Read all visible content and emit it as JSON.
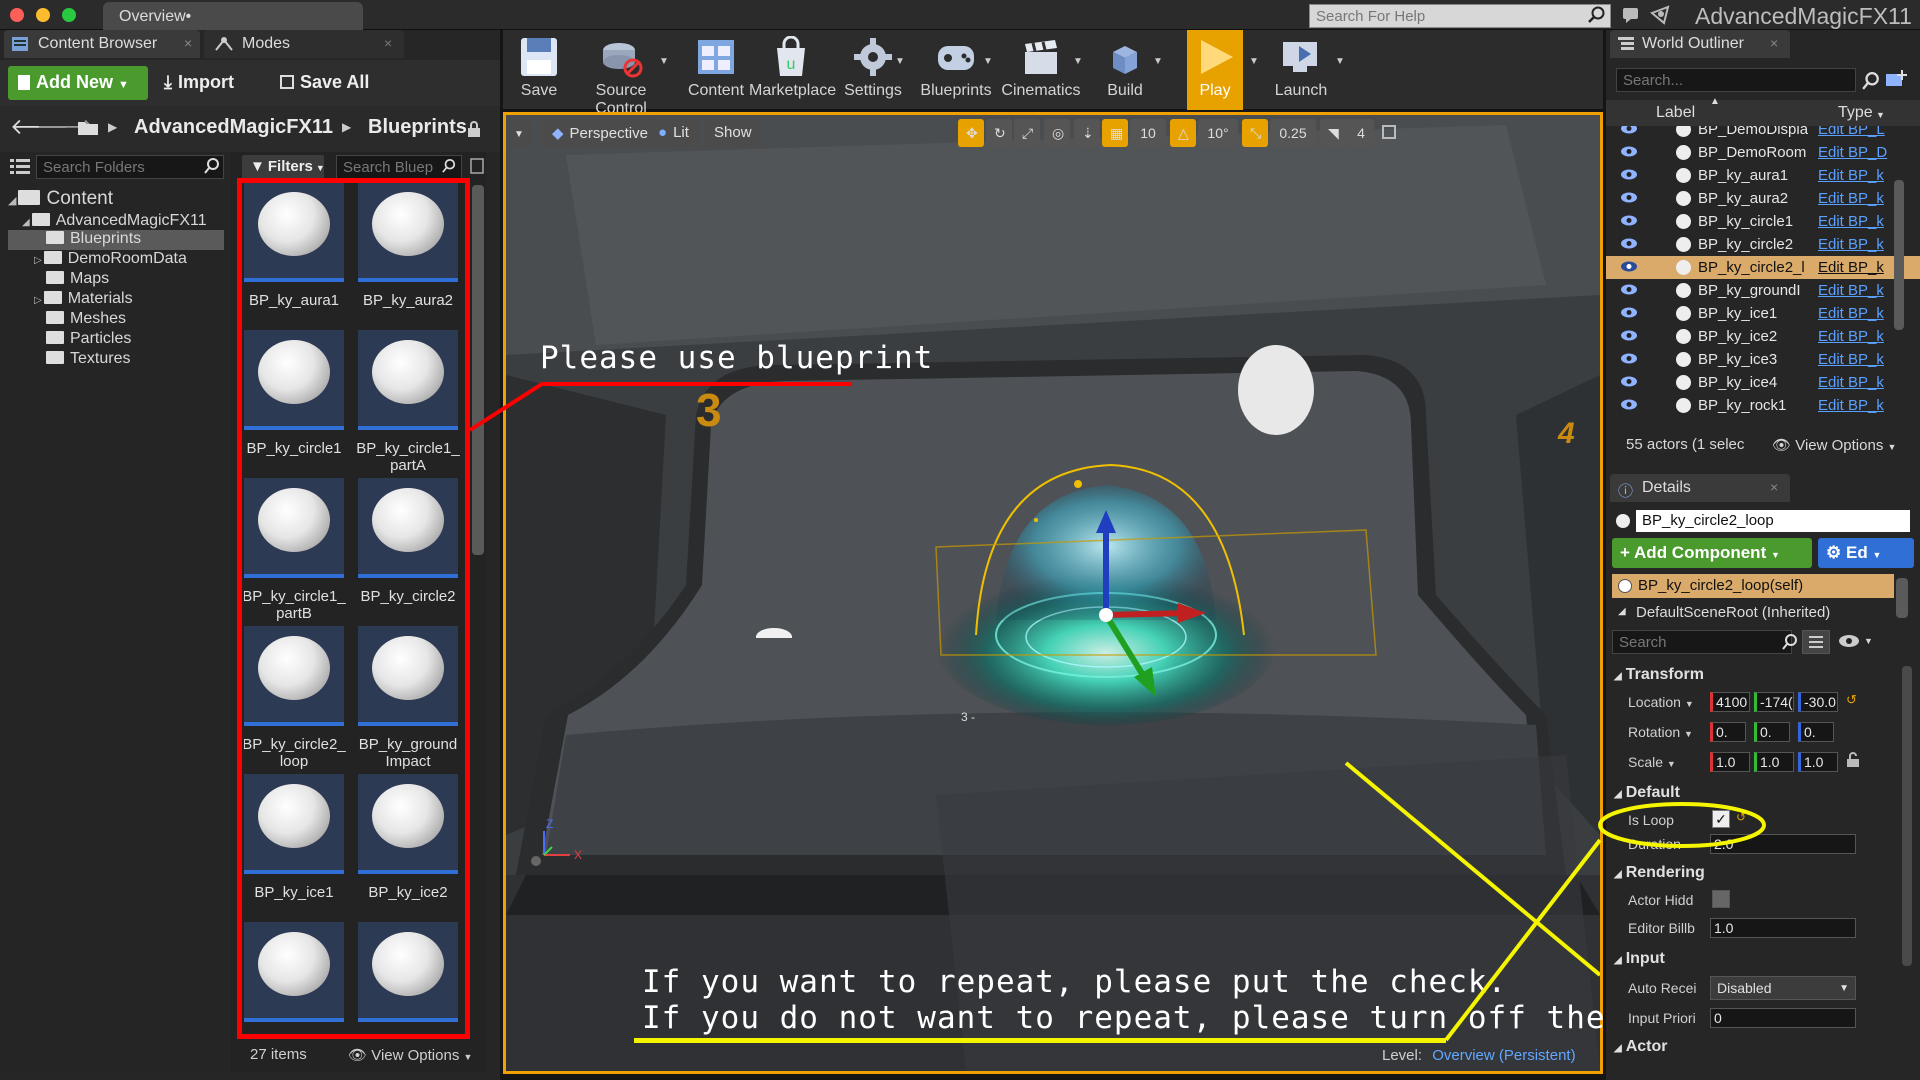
{
  "window": {
    "tab": "Overview•",
    "help_search_placeholder": "Search For Help",
    "app_title": "AdvancedMagicFX11"
  },
  "content_browser": {
    "tab_label": "Content Browser",
    "modes_tab": "Modes",
    "add_new": "Add New",
    "import": "Import",
    "save_all": "Save All",
    "path_root": "AdvancedMagicFX11",
    "path_leaf": "Blueprints",
    "search_folders": "Search Folders",
    "filters": "Filters",
    "search_assets": "Search Bluep",
    "tree": {
      "root": "Content",
      "items": [
        "AdvancedMagicFX11",
        "Blueprints",
        "DemoRoomData",
        "Maps",
        "Materials",
        "Meshes",
        "Particles",
        "Textures"
      ]
    },
    "assets": [
      {
        "l1": "BP_ky_aura1",
        "l2": ""
      },
      {
        "l1": "BP_ky_aura2",
        "l2": ""
      },
      {
        "l1": "BP_ky_circle1",
        "l2": ""
      },
      {
        "l1": "BP_ky_circle1_",
        "l2": "partA"
      },
      {
        "l1": "BP_ky_circle1_",
        "l2": "partB"
      },
      {
        "l1": "BP_ky_circle2",
        "l2": ""
      },
      {
        "l1": "BP_ky_circle2_",
        "l2": "loop"
      },
      {
        "l1": "BP_ky_ground",
        "l2": "Impact"
      },
      {
        "l1": "BP_ky_ice1",
        "l2": ""
      },
      {
        "l1": "BP_ky_ice2",
        "l2": ""
      },
      {
        "l1": "",
        "l2": ""
      },
      {
        "l1": "",
        "l2": ""
      }
    ],
    "item_count": "27 items",
    "view_options": "View Options"
  },
  "toolbar": {
    "buttons": [
      "Save",
      "Source Control",
      "Content",
      "Marketplace",
      "Settings",
      "Blueprints",
      "Cinematics",
      "Build",
      "Play",
      "Launch"
    ]
  },
  "viewport": {
    "perspective": "Perspective",
    "lit": "Lit",
    "show": "Show",
    "grid_snap": "10",
    "rot_snap": "10°",
    "scale_snap": "0.25",
    "cam_speed": "4",
    "room_number_left": "3",
    "room_number_right": "4",
    "floor_marker": "3 -",
    "axis_z": "Z",
    "axis_x": "X",
    "level_label": "Level:",
    "level_name": "Overview (Persistent)",
    "annotation_blueprint": "Please use blueprint",
    "annotation_line1": "If you want to repeat, please put the check.",
    "annotation_line2": "If you do not want to repeat, please turn off the check."
  },
  "outliner": {
    "tab": "World Outliner",
    "search_placeholder": "Search...",
    "col_label": "Label",
    "col_type": "Type",
    "rows": [
      {
        "label": "BP_DemoDispla",
        "type": "Edit BP_L"
      },
      {
        "label": "BP_DemoRoom",
        "type": "Edit BP_D"
      },
      {
        "label": "BP_ky_aura1",
        "type": "Edit BP_k"
      },
      {
        "label": "BP_ky_aura2",
        "type": "Edit BP_k"
      },
      {
        "label": "BP_ky_circle1",
        "type": "Edit BP_k"
      },
      {
        "label": "BP_ky_circle2",
        "type": "Edit BP_k"
      },
      {
        "label": "BP_ky_circle2_l",
        "type": "Edit BP_k"
      },
      {
        "label": "BP_ky_groundI",
        "type": "Edit BP_k"
      },
      {
        "label": "BP_ky_ice1",
        "type": "Edit BP_k"
      },
      {
        "label": "BP_ky_ice2",
        "type": "Edit BP_k"
      },
      {
        "label": "BP_ky_ice3",
        "type": "Edit BP_k"
      },
      {
        "label": "BP_ky_ice4",
        "type": "Edit BP_k"
      },
      {
        "label": "BP_ky_rock1",
        "type": "Edit BP_k"
      }
    ],
    "status": "55 actors (1 selec",
    "view_options": "View Options"
  },
  "details": {
    "tab": "Details",
    "actor_name": "BP_ky_circle2_loop",
    "add_component": "Add Component",
    "edit_blueprint": "Ed",
    "self_component": "BP_ky_circle2_loop(self)",
    "scene_root": "DefaultSceneRoot (Inherited)",
    "search_placeholder": "Search",
    "transform": {
      "heading": "Transform",
      "location_label": "Location",
      "location": [
        "4100",
        "-174(",
        "-30.0"
      ],
      "rotation_label": "Rotation",
      "rotation": [
        "0.",
        "0.",
        "0."
      ],
      "scale_label": "Scale",
      "scale": [
        "1.0",
        "1.0",
        "1.0"
      ]
    },
    "default": {
      "heading": "Default",
      "is_loop_label": "Is Loop",
      "is_loop": true,
      "duration_label": "Duration",
      "duration": "2.0"
    },
    "rendering": {
      "heading": "Rendering",
      "actor_hidden_label": "Actor Hidd",
      "editor_billboard_label": "Editor Billb",
      "editor_billboard": "1.0"
    },
    "input": {
      "heading": "Input",
      "auto_receive_label": "Auto Recei",
      "auto_receive": "Disabled",
      "input_priority_label": "Input Priori",
      "input_priority": "0"
    },
    "actor_heading": "Actor"
  },
  "colors": {
    "accent_orange": "#e8a200",
    "add_green": "#4a9a2e",
    "annotation_red": "#ff0000",
    "annotation_yellow": "#f5f500",
    "selection_blue": "#2f6fd6"
  }
}
